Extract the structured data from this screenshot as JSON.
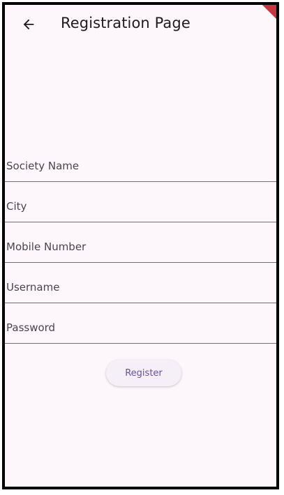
{
  "app_bar": {
    "back_icon": "arrow-back-icon",
    "title": "Registration Page"
  },
  "form": {
    "fields": [
      {
        "placeholder": "Society Name",
        "value": ""
      },
      {
        "placeholder": "City",
        "value": ""
      },
      {
        "placeholder": "Mobile Number",
        "value": ""
      },
      {
        "placeholder": "Username",
        "value": ""
      },
      {
        "placeholder": "Password",
        "value": ""
      }
    ],
    "submit_label": "Register"
  },
  "colors": {
    "background": "#fdf7fb",
    "accent": "#6750a4",
    "button_surface": "#f5eff7",
    "banner": "#c9363f"
  }
}
